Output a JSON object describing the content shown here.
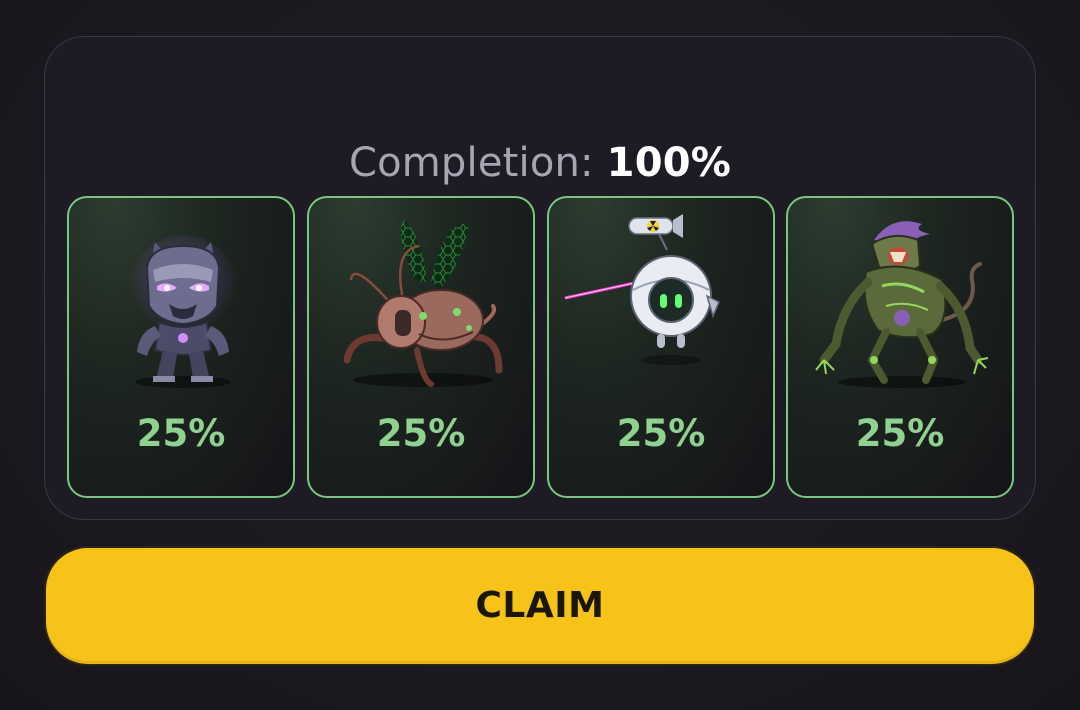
{
  "progress": {
    "label": "Completion:",
    "value": "100%"
  },
  "rewards": [
    {
      "icon": "robot-panther-icon",
      "percent": "25%"
    },
    {
      "icon": "mech-insect-icon",
      "percent": "25%"
    },
    {
      "icon": "orb-drone-icon",
      "percent": "25%"
    },
    {
      "icon": "mutant-beast-icon",
      "percent": "25%"
    }
  ],
  "claim_button": {
    "label": "CLAIM"
  },
  "colors": {
    "accent_green": "#79c77f",
    "claim_yellow": "#f7c319",
    "background": "#1c1a20"
  }
}
